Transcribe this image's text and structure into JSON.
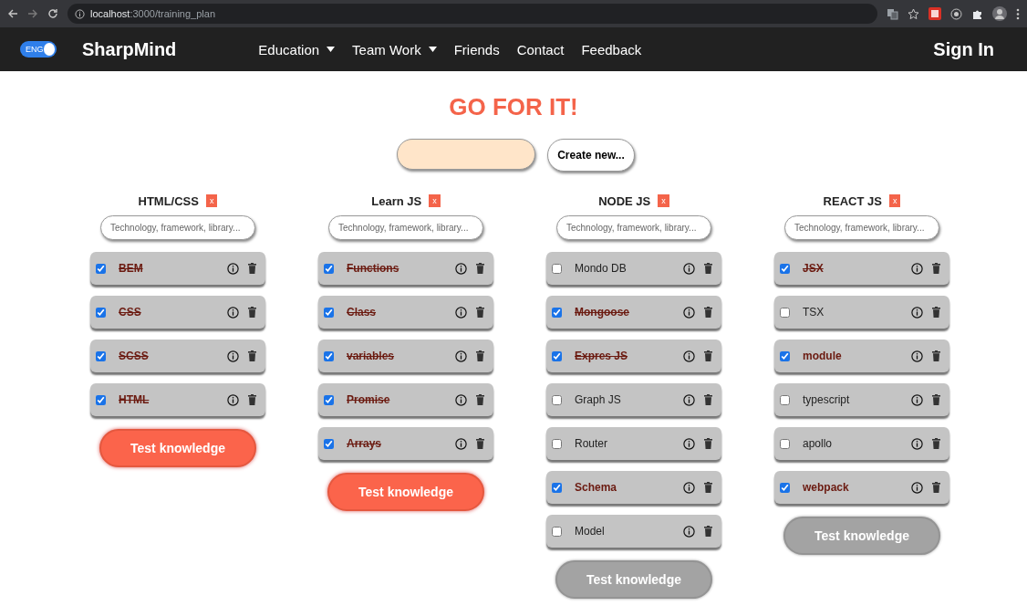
{
  "browser": {
    "url_host": "localhost",
    "url_path": ":3000/training_plan"
  },
  "navbar": {
    "language": {
      "label": "ENG",
      "on": true
    },
    "brand": "SharpMind",
    "menu": [
      {
        "label": "Education",
        "dropdown": true
      },
      {
        "label": "Team Work",
        "dropdown": true
      },
      {
        "label": "Friends",
        "dropdown": false
      },
      {
        "label": "Contact",
        "dropdown": false
      },
      {
        "label": "Feedback",
        "dropdown": false
      }
    ],
    "sign_in": "Sign In"
  },
  "heading": "GO FOR IT!",
  "create": {
    "button": "Create new..."
  },
  "columns": [
    {
      "title": "HTML/CSS",
      "remove": "x",
      "placeholder": "Technology, framework, library...",
      "test_button": {
        "label": "Test knowledge",
        "disabled": false
      },
      "items": [
        {
          "label": "BEM",
          "checked": true,
          "struck": true
        },
        {
          "label": "CSS",
          "checked": true,
          "struck": true
        },
        {
          "label": "SCSS",
          "checked": true,
          "struck": true
        },
        {
          "label": "HTML",
          "checked": true,
          "struck": true
        }
      ]
    },
    {
      "title": "Learn JS",
      "remove": "x",
      "placeholder": "Technology, framework, library...",
      "test_button": {
        "label": "Test knowledge",
        "disabled": false
      },
      "items": [
        {
          "label": "Functions",
          "checked": true,
          "struck": true
        },
        {
          "label": "Class",
          "checked": true,
          "struck": true
        },
        {
          "label": "variables",
          "checked": true,
          "struck": true
        },
        {
          "label": "Promise",
          "checked": true,
          "struck": true
        },
        {
          "label": "Arrays",
          "checked": true,
          "struck": true
        }
      ]
    },
    {
      "title": "NODE JS",
      "remove": "x",
      "placeholder": "Technology, framework, library...",
      "test_button": {
        "label": "Test knowledge",
        "disabled": true
      },
      "items": [
        {
          "label": "Mondo DB",
          "checked": false,
          "struck": false
        },
        {
          "label": "Mongoose",
          "checked": true,
          "struck": true
        },
        {
          "label": "Expres JS",
          "checked": true,
          "struck": true
        },
        {
          "label": "Graph JS",
          "checked": false,
          "struck": false
        },
        {
          "label": "Router",
          "checked": false,
          "struck": false
        },
        {
          "label": "Schema",
          "checked": true,
          "struck": false
        },
        {
          "label": "Model",
          "checked": false,
          "struck": false
        }
      ]
    },
    {
      "title": "REACT JS",
      "remove": "x",
      "placeholder": "Technology, framework, library...",
      "test_button": {
        "label": "Test knowledge",
        "disabled": true
      },
      "items": [
        {
          "label": "JSX",
          "checked": true,
          "struck": true
        },
        {
          "label": "TSX",
          "checked": false,
          "struck": false
        },
        {
          "label": "module",
          "checked": true,
          "struck": false
        },
        {
          "label": "typescript",
          "checked": false,
          "struck": false
        },
        {
          "label": "apollo",
          "checked": false,
          "struck": false
        },
        {
          "label": "webpack",
          "checked": true,
          "struck": false
        }
      ]
    }
  ]
}
